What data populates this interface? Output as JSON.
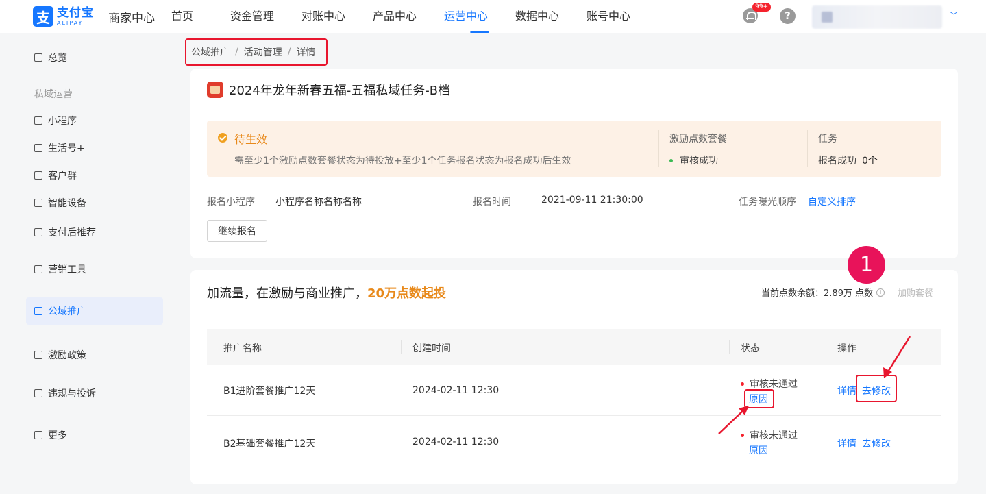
{
  "header": {
    "logo_cn": "支付宝",
    "logo_en": "ALIPAY",
    "logo_sub": "商家中心",
    "nav": [
      "首页",
      "资金管理",
      "对账中心",
      "产品中心",
      "运营中心",
      "数据中心",
      "账号中心"
    ],
    "active_nav": "运营中心",
    "badge": "99+",
    "help": "?"
  },
  "sidebar": {
    "overview": "总览",
    "group_private": "私域运营",
    "mini_program": "小程序",
    "life_account": "生活号+",
    "customer_group": "客户群",
    "smart_device": "智能设备",
    "after_pay": "支付后推荐",
    "marketing_tools": "营销工具",
    "public_promo": "公域推广",
    "incentive": "激励政策",
    "violation": "违规与投诉",
    "more": "更多"
  },
  "breadcrumb": [
    "公域推广",
    "活动管理",
    "详情"
  ],
  "activity": {
    "title": "2024年龙年新春五福-五福私域任务-B档",
    "status_title": "待生效",
    "status_desc": "需至少1个激励点数套餐状态为待投放+至少1个任务报名状态为报名成功后生效",
    "pkg_header": "激励点数套餐",
    "pkg_status": "审核成功",
    "task_header": "任务",
    "task_label": "报名成功",
    "task_count": "0个",
    "mini_label": "报名小程序",
    "mini_value": "小程序名称名称名称",
    "time_label": "报名时间",
    "time_value": "2021-09-11 21:30:00",
    "order_label": "任务曝光顺序",
    "order_value": "自定义排序",
    "continue_btn": "继续报名"
  },
  "promo": {
    "title_prefix": "加流量，在激励与商业推广，",
    "title_highlight": "20万点数起投",
    "balance_label": "当前点数余额：",
    "balance_value": "2.89万 点数",
    "buy_pkg": "加购套餐",
    "step_badge": "1",
    "columns": [
      "推广名称",
      "创建时间",
      "状态",
      "操作"
    ],
    "rows": [
      {
        "name": "B1进阶套餐推广12天",
        "created": "2024-02-11 12:30",
        "status": "审核未通过",
        "reason": "原因",
        "detail": "详情",
        "edit": "去修改"
      },
      {
        "name": "B2基础套餐推广12天",
        "created": "2024-02-11 12:30",
        "status": "审核未通过",
        "reason": "原因",
        "detail": "详情",
        "edit": "去修改"
      }
    ]
  },
  "colors": {
    "accent": "#1677ff",
    "highlight_red": "#e8162e",
    "warning_orange": "#e8891a"
  }
}
